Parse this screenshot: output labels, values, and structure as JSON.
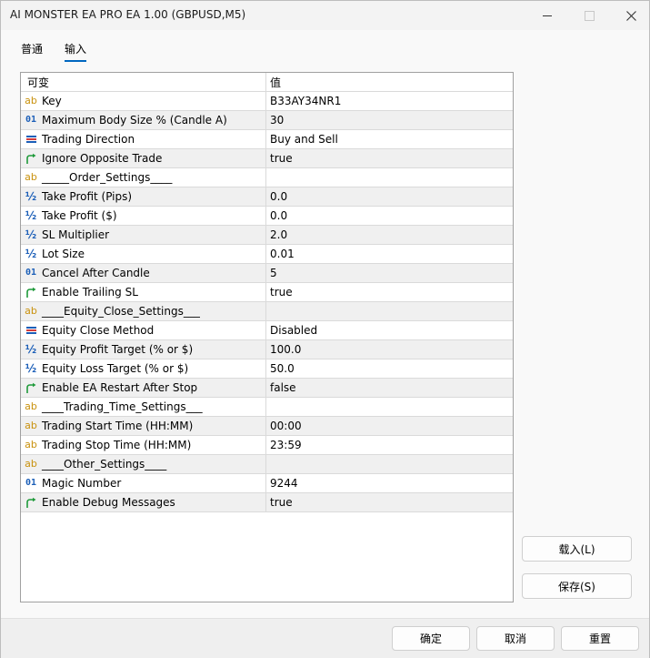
{
  "window": {
    "title": "AI MONSTER EA PRO EA 1.00 (GBPUSD,M5)"
  },
  "tabs": [
    {
      "label": "普通",
      "active": false
    },
    {
      "label": "输入",
      "active": true
    }
  ],
  "grid": {
    "header": {
      "name": "可变",
      "value": "值"
    },
    "rows": [
      {
        "icon": "ab",
        "name": "Key",
        "value": "B33AY34NR1"
      },
      {
        "icon": "int",
        "name": "Maximum Body Size % (Candle A)",
        "value": "30"
      },
      {
        "icon": "enum",
        "name": "Trading Direction",
        "value": "Buy and Sell"
      },
      {
        "icon": "bool",
        "name": "Ignore Opposite Trade",
        "value": "true"
      },
      {
        "icon": "ab",
        "name": "_____Order_Settings____",
        "value": ""
      },
      {
        "icon": "dbl",
        "name": "Take Profit (Pips)",
        "value": "0.0"
      },
      {
        "icon": "dbl",
        "name": "Take Profit ($)",
        "value": "0.0"
      },
      {
        "icon": "dbl",
        "name": "SL Multiplier",
        "value": "2.0"
      },
      {
        "icon": "dbl",
        "name": "Lot Size",
        "value": "0.01"
      },
      {
        "icon": "int",
        "name": "Cancel After Candle",
        "value": "5"
      },
      {
        "icon": "bool",
        "name": "Enable Trailing SL",
        "value": "true"
      },
      {
        "icon": "ab",
        "name": "____Equity_Close_Settings___",
        "value": ""
      },
      {
        "icon": "enum",
        "name": "Equity Close Method",
        "value": "Disabled"
      },
      {
        "icon": "dbl",
        "name": "Equity Profit Target (% or $)",
        "value": "100.0"
      },
      {
        "icon": "dbl",
        "name": "Equity Loss Target (% or $)",
        "value": "50.0"
      },
      {
        "icon": "bool",
        "name": "Enable EA Restart After Stop",
        "value": "false"
      },
      {
        "icon": "ab",
        "name": "____Trading_Time_Settings___",
        "value": ""
      },
      {
        "icon": "ab",
        "name": "Trading Start Time (HH:MM)",
        "value": "00:00"
      },
      {
        "icon": "ab",
        "name": "Trading Stop Time (HH:MM)",
        "value": "23:59"
      },
      {
        "icon": "ab",
        "name": "____Other_Settings____",
        "value": ""
      },
      {
        "icon": "int",
        "name": "Magic Number",
        "value": "9244"
      },
      {
        "icon": "bool",
        "name": "Enable Debug Messages",
        "value": "true"
      }
    ]
  },
  "buttons": {
    "load": "载入(L)",
    "save": "保存(S)",
    "ok": "确定",
    "cancel": "取消",
    "reset": "重置"
  },
  "icons": {
    "string": "string-ab-icon",
    "integer": "integer-01-icon",
    "double": "double-half-icon",
    "enum": "enum-list-icon",
    "bool": "bool-arrow-icon"
  },
  "colors": {
    "accent": "#0067c0",
    "string_icon": "#c9910c",
    "numeric_icon": "#1c5fb8",
    "bool_icon": "#1f9a3a",
    "row_alt": "#f0f0f0"
  }
}
